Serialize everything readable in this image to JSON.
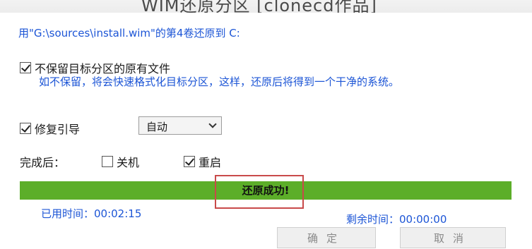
{
  "window": {
    "title": "WIM还原分区 [clonecd作品]"
  },
  "source_line": "用\"G:\\sources\\install.wim\"的第4卷还原到 C:",
  "options": {
    "keep_files": {
      "label": "不保留目标分区的原有文件",
      "checked": true
    },
    "hint": "如不保留，将会快速格式化目标分区，这样，还原后将得到一个干净的系统。",
    "repair_boot": {
      "label": "修复引导",
      "checked": true
    },
    "boot_mode": {
      "value": "自动"
    }
  },
  "after_complete": {
    "label": "完成后：",
    "shutdown": {
      "label": "关机",
      "checked": false
    },
    "restart": {
      "label": "重启",
      "checked": true
    }
  },
  "progress": {
    "status": "还原成功!",
    "percent": 100,
    "fill_color": "#5cae29"
  },
  "times": {
    "elapsed": "已用时间：00:02:15",
    "remaining": "剩余时间：00:00:00"
  },
  "buttons": {
    "ok": "确定",
    "cancel": "取消"
  },
  "colors": {
    "accent_text": "#1c55d6",
    "highlight_box": "#c94a4a"
  }
}
